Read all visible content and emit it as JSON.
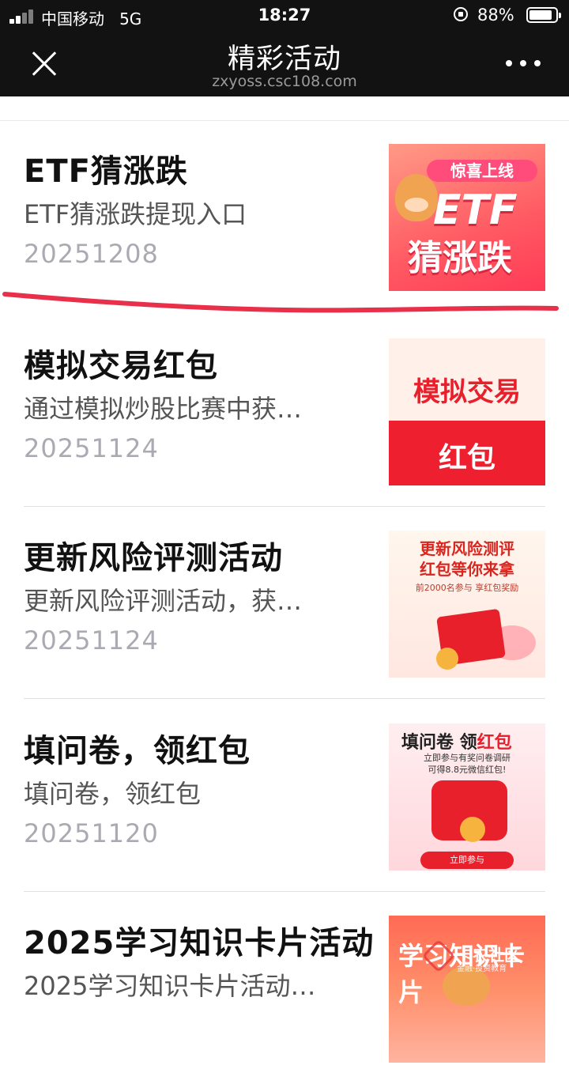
{
  "status_bar": {
    "carrier": "中国移动",
    "network": "5G",
    "time": "18:27",
    "battery_percent": "88%",
    "battery_level": 0.88
  },
  "nav": {
    "title": "精彩活动",
    "url": "zxyoss.csc108.com"
  },
  "items": [
    {
      "title": "ETF猜涨跌",
      "desc": "ETF猜涨跌提现入口",
      "date": "20251208",
      "thumb": {
        "badge": "惊喜上线",
        "line1": "ETF",
        "line2": "猜涨跌"
      }
    },
    {
      "title": "模拟交易红包",
      "desc": "通过模拟炒股比赛中获…",
      "date": "20251124",
      "thumb": {
        "line1": "模拟交易",
        "line2": "红包"
      }
    },
    {
      "title": "更新风险评测活动",
      "desc": "更新风险评测活动，获…",
      "date": "20251124",
      "thumb": {
        "line1": "更新风险测评",
        "line1b": "红包等你来拿",
        "line2": "前2000名参与  享红包奖励"
      }
    },
    {
      "title": "填问卷，领红包",
      "desc": "填问卷，领红包",
      "date": "20251120",
      "thumb": {
        "line1a": "填问卷 领",
        "line1b": "红包",
        "line2a": "立即参与有奖问卷调研",
        "line2b": "可得8.8元微信红包!",
        "cta": "立即参与"
      }
    },
    {
      "title": "2025学习知识卡片活动",
      "desc": "2025学习知识卡片活动…",
      "date": "",
      "thumb": {
        "line1": "学习知识卡片"
      }
    }
  ],
  "watermark": {
    "text": "卡农社区",
    "sub": "金融·投资教育"
  },
  "colors": {
    "annotation": "#e8304a",
    "topbar": "#121212"
  }
}
